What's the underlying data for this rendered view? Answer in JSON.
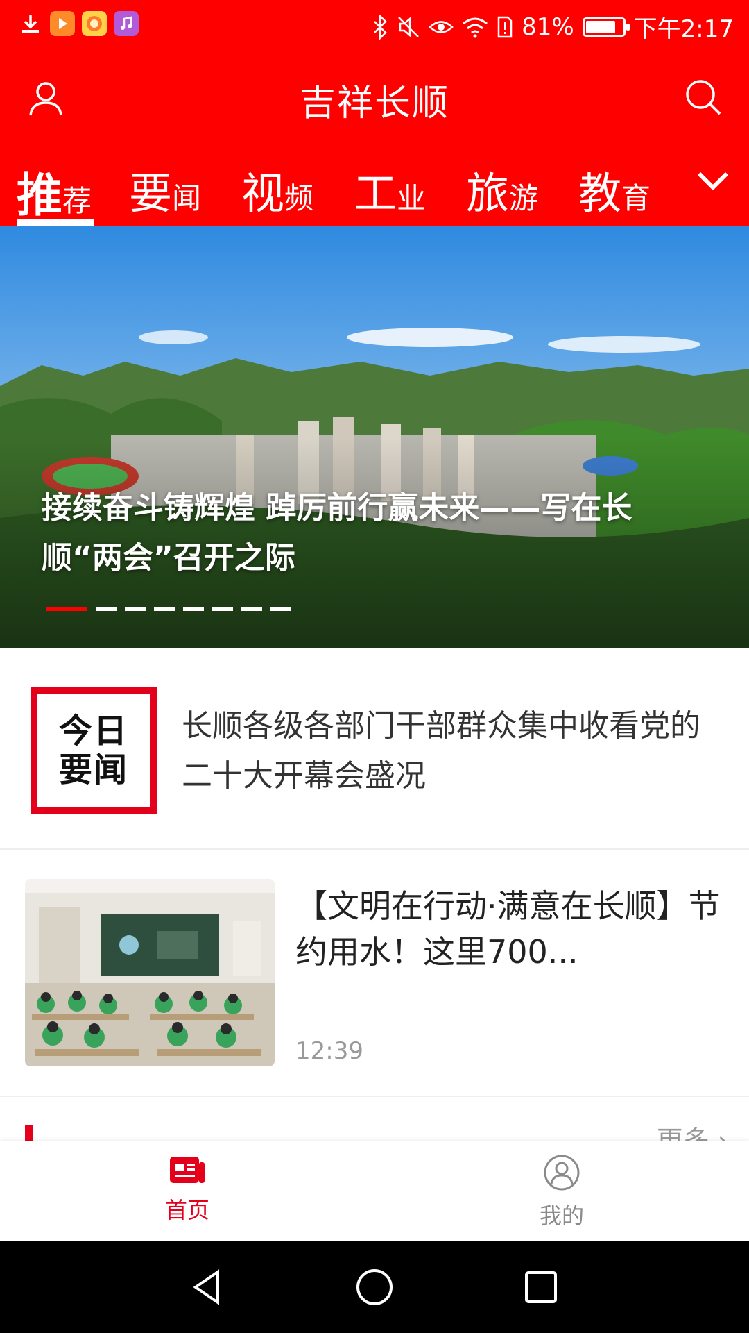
{
  "status_bar": {
    "battery": "81%",
    "battery_level": 0.81,
    "time": "下午2:17",
    "app_icons": [
      "download-icon",
      "video-app-icon",
      "game-app-icon",
      "music-app-icon"
    ]
  },
  "header": {
    "title": "吉祥长顺"
  },
  "channels": [
    {
      "big": "推",
      "small": "荐",
      "active": true
    },
    {
      "big": "要",
      "small": "闻",
      "active": false
    },
    {
      "big": "视",
      "small": "频",
      "active": false
    },
    {
      "big": "工",
      "small": "业",
      "active": false
    },
    {
      "big": "旅",
      "small": "游",
      "active": false
    },
    {
      "big": "教",
      "small": "育",
      "active": false
    }
  ],
  "banner": {
    "caption": "接续奋斗铸辉煌 踔厉前行赢未来——写在长顺“两会”召开之际",
    "slide_count": 8,
    "active_slide": 1
  },
  "today": {
    "logo_line1": "今日",
    "logo_line2": "要闻",
    "headline": "长顺各级各部门干部群众集中收看党的二十大开幕会盛况"
  },
  "article": {
    "title": "【文明在行动·满意在长顺】节约用水！这里700...",
    "time": "12:39"
  },
  "section": {
    "more": "更多 ›"
  },
  "bottom_nav": {
    "home": "首页",
    "mine": "我的"
  },
  "colors": {
    "brand_red": "#ff0000",
    "accent_red": "#e4001b",
    "muted_text": "#999999"
  }
}
